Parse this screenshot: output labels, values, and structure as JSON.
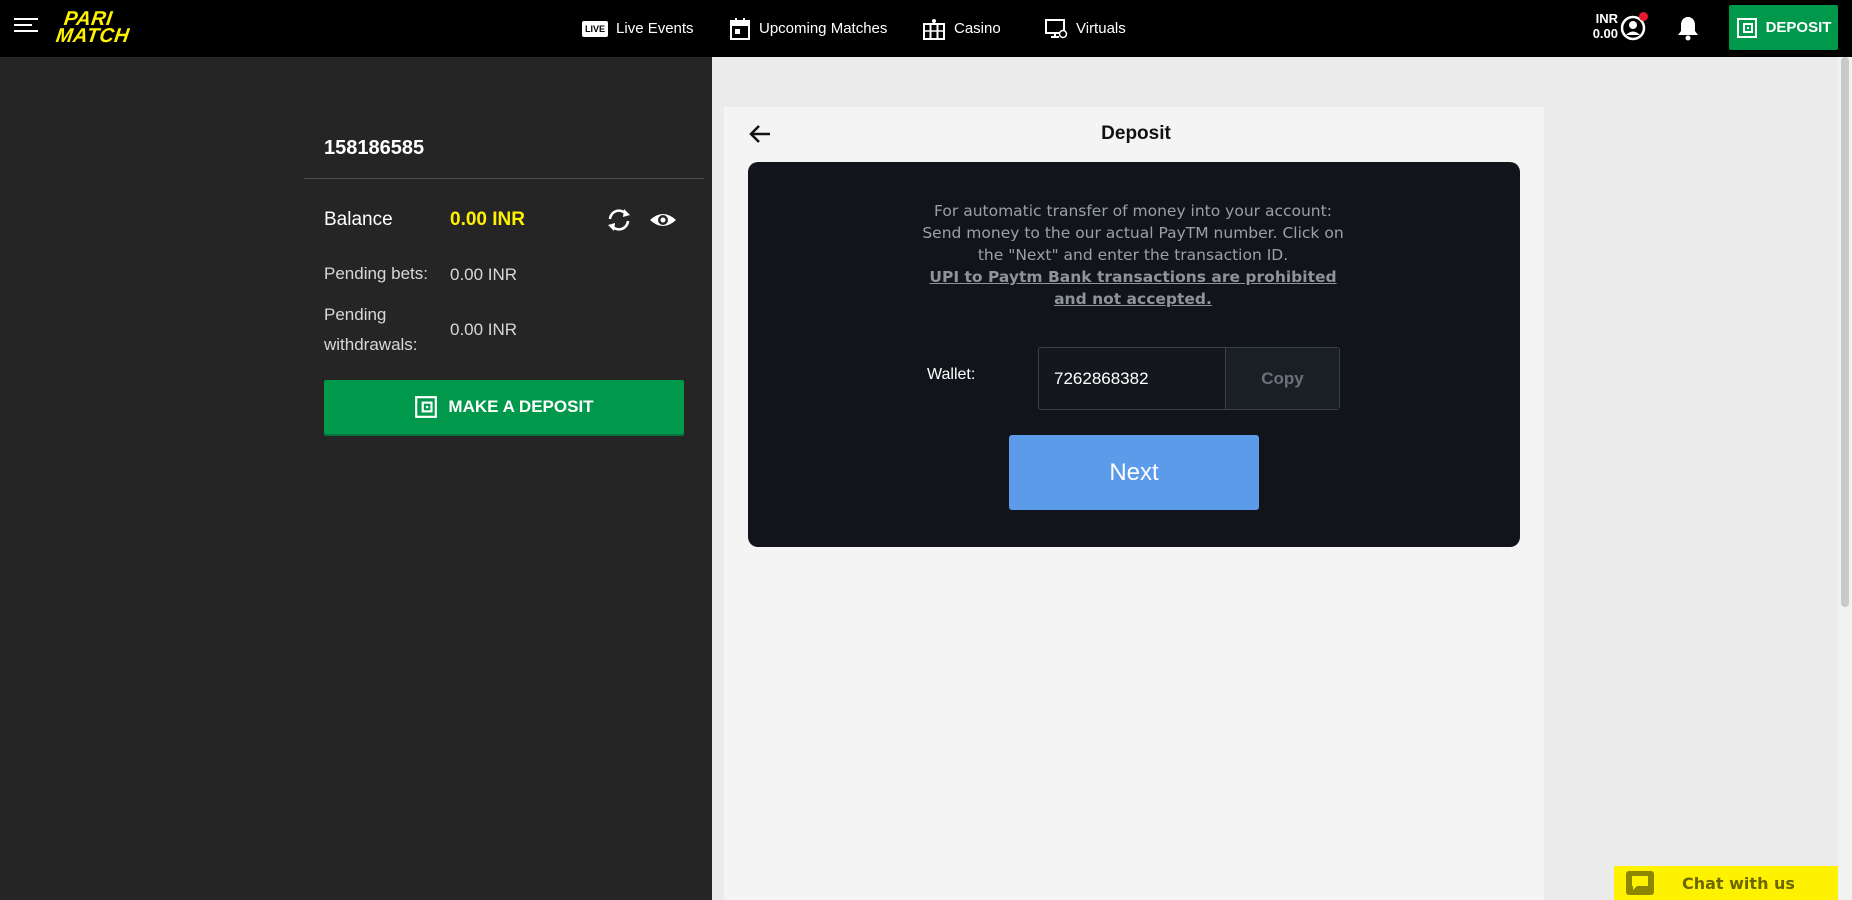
{
  "header": {
    "logo_line1": "PARI",
    "logo_line2": "MATCH",
    "nav": [
      {
        "label": "Live Events",
        "badge": "LIVE"
      },
      {
        "label": "Upcoming Matches"
      },
      {
        "label": "Casino"
      },
      {
        "label": "Virtuals"
      }
    ],
    "balance_currency": "INR",
    "balance_amount": "0.00",
    "deposit_label": "DEPOSIT"
  },
  "account": {
    "id": "158186585",
    "balance_label": "Balance",
    "balance_value": "0.00 INR",
    "pending_bets_label": "Pending bets:",
    "pending_bets_value": "0.00 INR",
    "pending_withdrawals_label": "Pending withdrawals:",
    "pending_withdrawals_value": "0.00 INR",
    "make_deposit_label": "MAKE A DEPOSIT"
  },
  "deposit": {
    "title": "Deposit",
    "info_line1": "For automatic transfer of money into your account:",
    "info_line2": "Send money to the our actual PayTM number. Click on the \"Next\" and enter the transaction ID.",
    "warning": "UPI to Paytm Bank transactions are prohibited and not accepted.",
    "wallet_label": "Wallet:",
    "wallet_value": "7262868382",
    "copy_label": "Copy",
    "next_label": "Next"
  },
  "chat": {
    "label": "Chat with us"
  },
  "colors": {
    "brand_yellow": "#fff200",
    "deposit_green": "#00984a",
    "next_blue": "#5b9bea",
    "notification_red": "#e8192c"
  },
  "icons": [
    "menu-icon",
    "live-icon",
    "calendar-icon",
    "casino-icon",
    "virtuals-icon",
    "avatar-icon",
    "bell-icon",
    "wallet-icon",
    "refresh-icon",
    "eye-icon",
    "back-arrow-icon",
    "chat-icon"
  ]
}
